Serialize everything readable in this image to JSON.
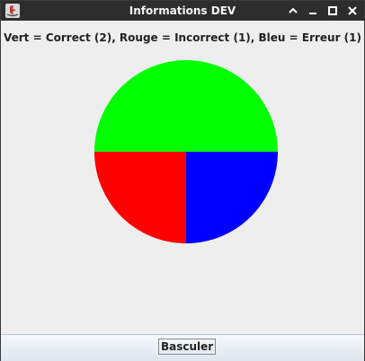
{
  "window": {
    "title": "Informations DEV",
    "controls": [
      "chevron-up-icon",
      "minimize-icon",
      "maximize-icon",
      "close-icon"
    ]
  },
  "legend_text": "Vert = Correct (2), Rouge = Incorrect (1), Bleu = Erreur (1)",
  "chart_data": {
    "type": "pie",
    "slices": [
      {
        "label": "Vert",
        "value": 2,
        "color": "#00ff00"
      },
      {
        "label": "Rouge",
        "value": 1,
        "color": "#ff0000"
      },
      {
        "label": "Bleu",
        "value": 1,
        "color": "#0000ff"
      }
    ]
  },
  "button": {
    "label": "Basculer"
  }
}
